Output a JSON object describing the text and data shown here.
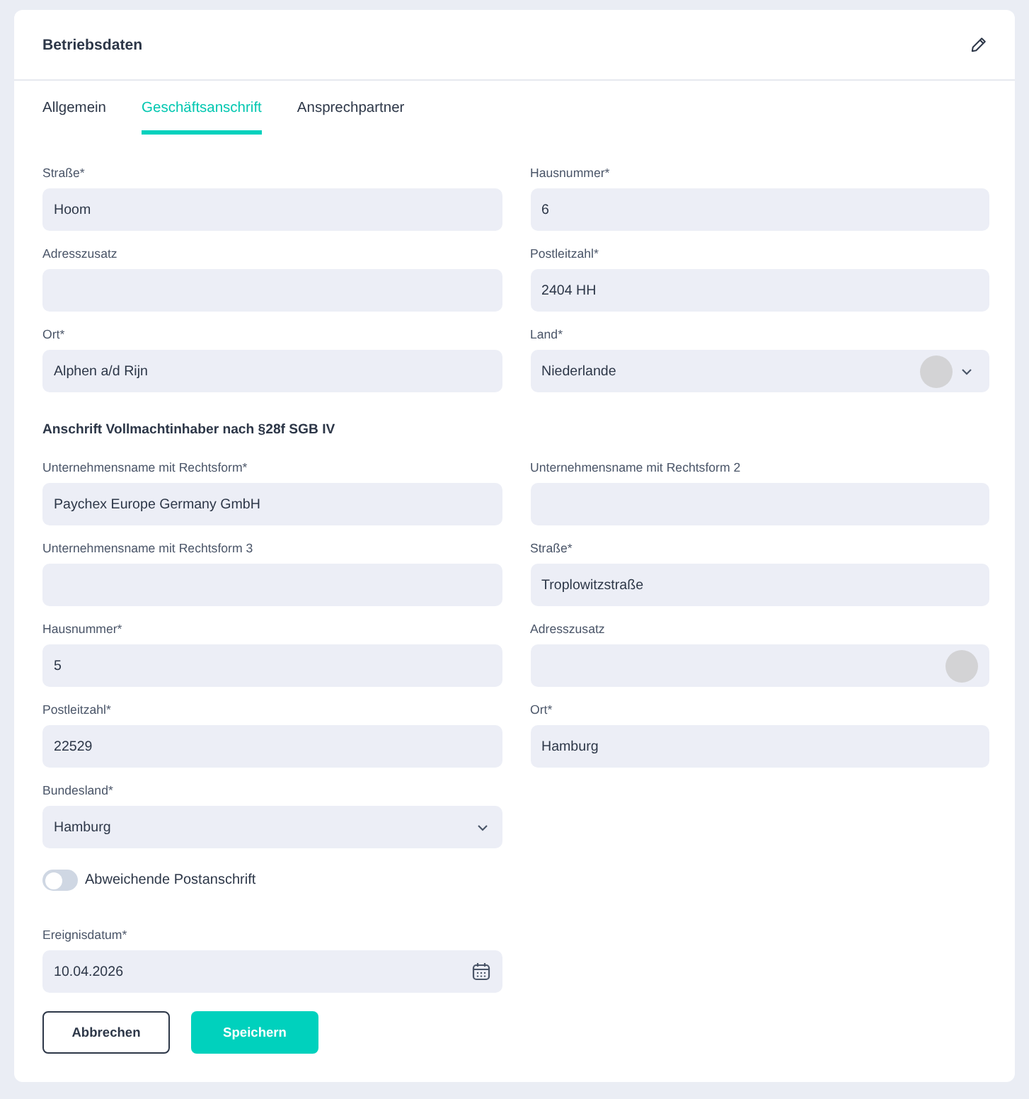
{
  "card": {
    "title": "Betriebsdaten"
  },
  "tabs": [
    {
      "label": "Allgemein",
      "selected": false
    },
    {
      "label": "Geschäftsanschrift",
      "selected": true
    },
    {
      "label": "Ansprechpartner",
      "selected": false
    }
  ],
  "address_fields": [
    {
      "label": "Straße*",
      "value": "Hoom",
      "kind": "input",
      "disc": false
    },
    {
      "label": "Hausnummer*",
      "value": "6",
      "kind": "input",
      "disc": false
    },
    {
      "label": "Adresszusatz",
      "kind": "input",
      "disc": false
    },
    {
      "label": "Postleitzahl*",
      "value": "2404 HH",
      "kind": "input",
      "disc": false
    },
    {
      "label": "Ort*",
      "value": "Alphen a/d Rijn",
      "kind": "input",
      "disc": false
    },
    {
      "label": "Land*",
      "value": "Niederlande",
      "kind": "select",
      "disc": true
    }
  ],
  "section": {
    "title": "Anschrift Vollmachtinhaber nach §28f SGB IV"
  },
  "proxy_fields": [
    {
      "label": "Unternehmensname mit Rechtsform*",
      "value": "Paychex Europe Germany GmbH",
      "kind": "input",
      "disc": false
    },
    {
      "label": "Unternehmensname mit Rechtsform 2",
      "kind": "input",
      "disc": false
    },
    {
      "label": "Unternehmensname mit Rechtsform 3",
      "kind": "input",
      "disc": false
    },
    {
      "label": "Straße*",
      "value": "Troplowitzstraße",
      "kind": "input",
      "disc": false
    },
    {
      "label": "Hausnummer*",
      "value": "5",
      "kind": "input",
      "disc": false
    },
    {
      "label": "Adresszusatz",
      "kind": "input",
      "disc": true
    },
    {
      "label": "Postleitzahl*",
      "value": "22529",
      "kind": "input",
      "disc": false
    },
    {
      "label": "Ort*",
      "value": "Hamburg",
      "kind": "input",
      "disc": false
    },
    {
      "label": "Bundesland*",
      "value": "Hamburg",
      "kind": "select",
      "disc": false
    }
  ],
  "toggle": {
    "label": "Abweichende Postanschrift",
    "on": false
  },
  "event_date": {
    "label": "Ereignisdatum*",
    "value": "10.04.2026",
    "kind": "date"
  },
  "buttons": [
    {
      "label": "Abbrechen",
      "kind": "secondary"
    },
    {
      "label": "Speichern",
      "kind": "primary"
    }
  ]
}
